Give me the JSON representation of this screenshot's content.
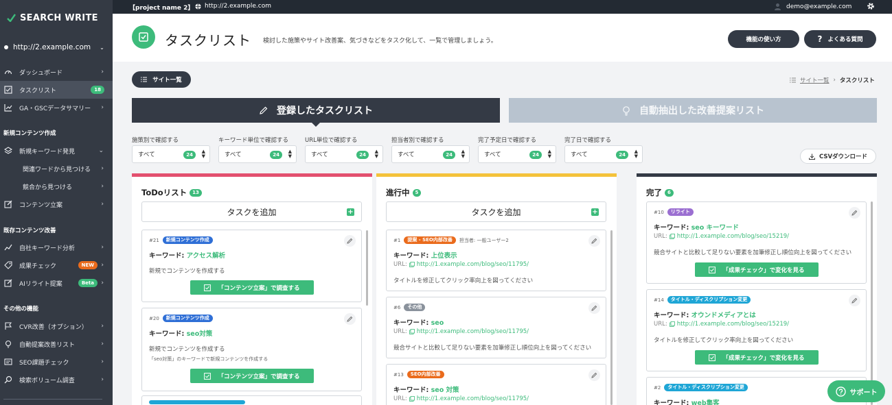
{
  "app": {
    "logo": "SEARCH WRITE"
  },
  "site_selector": {
    "label": "http://2.example.com"
  },
  "topbar": {
    "project": "【project name 2】",
    "url": "http://2.example.com",
    "user": "demo@example.com"
  },
  "sidebar": {
    "items": [
      {
        "label": "ダッシュボード"
      },
      {
        "label": "タスクリスト",
        "badge": "18"
      },
      {
        "label": "GA・GSCデータサマリー"
      }
    ],
    "sec_new": "新規コンテンツ作成",
    "new_items": [
      {
        "label": "新規キーワード発見"
      },
      {
        "label": "関連ワードから見つける"
      },
      {
        "label": "競合から見つける"
      },
      {
        "label": "コンテンツ立案"
      }
    ],
    "sec_existing": "既存コンテンツ改善",
    "existing_items": [
      {
        "label": "自社キーワード分析"
      },
      {
        "label": "成果チェック",
        "badge": "NEW"
      },
      {
        "label": "AIリライト提案",
        "badge": "Beta"
      }
    ],
    "sec_other": "その他の機能",
    "other_items": [
      {
        "label": "CVR改善（オプション）"
      },
      {
        "label": "自動提案改善リスト"
      },
      {
        "label": "SEO課題チェック"
      },
      {
        "label": "検索ボリューム調査"
      }
    ]
  },
  "header": {
    "title": "タスクリスト",
    "description": "検討した施策やサイト改善案、気づきなどをタスク化して、一覧で管理しましょう。",
    "howto_label": "機能の使い方",
    "faq_label": "よくある質問"
  },
  "toolbar": {
    "sites_label": "サイト一覧"
  },
  "breadcrumb": {
    "parent": "サイト一覧",
    "current": "タスクリスト"
  },
  "tabs": {
    "registered": "登録したタスクリスト",
    "auto": "自動抽出した改善提案リスト"
  },
  "filters": [
    {
      "label": "施策別で確認する",
      "value": "すべて",
      "count": "24"
    },
    {
      "label": "キーワード単位で確認する",
      "value": "すべて",
      "count": "24"
    },
    {
      "label": "URL単位で確認する",
      "value": "すべて",
      "count": "24"
    },
    {
      "label": "担当者別で確認する",
      "value": "すべて",
      "count": "24"
    },
    {
      "label": "完了予定日で確認する",
      "value": "すべて",
      "count": "24"
    },
    {
      "label": "完了日で確認する",
      "value": "すべて",
      "count": "24"
    }
  ],
  "csv_label": "CSVダウンロード",
  "add_task_label": "タスクを追加",
  "kw_label": "キーワード: ",
  "url_label": "URL: ",
  "colors": {
    "green": "#3dbb7b",
    "todo": "#e3506f",
    "progress": "#f4c23a",
    "done": "#343a45",
    "blue": "#2f6fd6",
    "orange": "#ea6b1c",
    "gray": "#8a929c",
    "purple": "#9b6fd1",
    "cyan": "#1fa6d6"
  },
  "columns": [
    {
      "title": "ToDoリスト",
      "count": "13",
      "cards": [
        {
          "id": "#21",
          "tag": "新規コンテンツ作成",
          "keyword": "アクセス解析",
          "memo": "新規でコンテンツを作成する",
          "cta": "「コンテンツ立案」で調査する"
        },
        {
          "id": "#20",
          "tag": "新規コンテンツ作成",
          "keyword": "seo対策",
          "memo": "新規でコンテンツを作成する",
          "memo2": "「seo対策」のキーワードで新規コンテンツを作成する",
          "cta": "「コンテンツ立案」で調査する"
        }
      ]
    },
    {
      "title": "進行中",
      "count": "5",
      "cards": [
        {
          "id": "#1",
          "tag": "提案 - SEO内部改善",
          "assignee": "担当者: 一般ユーザー2",
          "keyword": "上位表示",
          "url": "http://1.example.com/blog/seo/11795/",
          "memo": "タイトルを修正してクリック率向上を図ってください"
        },
        {
          "id": "#6",
          "tag": "その他",
          "keyword": "seo",
          "url": "http://1.example.com/blog/seo/11795/",
          "memo": "競合サイトと比較して足りない要素を加筆修正し順位向上を図ってください"
        },
        {
          "id": "#13",
          "tag": "SEO内部改善",
          "keyword": "seo 対策",
          "url": "http://1.example.com/blog/seo/11795/"
        }
      ]
    },
    {
      "title": "完了",
      "count": "6",
      "cards": [
        {
          "id": "#10",
          "tag": "リライト",
          "keyword": "seo キーワード",
          "url": "http://1.example.com/blog/seo/15219/",
          "memo": "競合サイトと比較して足りない要素を加筆修正し順位向上を図ってください",
          "cta": "「成果チェック」で変化を見る"
        },
        {
          "id": "#14",
          "tag": "タイトル・ディスクリプション変更",
          "keyword": "オウンドメディアとは",
          "url": "http://1.example.com/blog/seo/15219/",
          "memo": "タイトルを修正してクリック率向上を図ってください",
          "cta": "「成果チェック」で変化を見る"
        },
        {
          "id": "#2",
          "tag": "タイトル・ディスクリプション変更",
          "keyword": "web集客"
        }
      ]
    }
  ],
  "support_label": "サポート"
}
